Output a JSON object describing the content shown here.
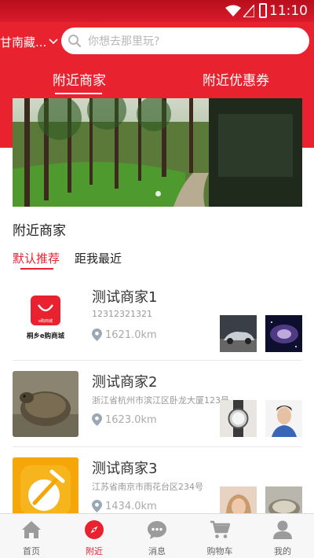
{
  "status_bar": {
    "time": "11:10"
  },
  "header": {
    "city": "甘南藏...",
    "search_placeholder": "你想去那里玩?",
    "tabs": [
      {
        "label": "附近商家"
      },
      {
        "label": "附近优惠券"
      }
    ]
  },
  "section": {
    "title": "附近商家",
    "filters": [
      {
        "label": "默认推荐"
      },
      {
        "label": "距我最近"
      }
    ]
  },
  "shops": [
    {
      "name": "测试商家1",
      "sub": "12312321321",
      "distance": "1621.0km",
      "logo_text": "桐乡e购商城",
      "logo_badge": "e购商城"
    },
    {
      "name": "测试商家2",
      "sub": "浙江省杭州市滨江区卧龙大厦123号",
      "distance": "1623.0km"
    },
    {
      "name": "测试商家3",
      "sub": "江苏省南京市雨花台区234号",
      "distance": "1434.0km"
    }
  ],
  "tabbar": [
    {
      "label": "首页",
      "icon": "home-icon"
    },
    {
      "label": "附近",
      "icon": "compass-icon"
    },
    {
      "label": "消息",
      "icon": "message-icon"
    },
    {
      "label": "购物车",
      "icon": "cart-icon"
    },
    {
      "label": "我的",
      "icon": "user-icon"
    }
  ],
  "colors": {
    "primary": "#e8222f",
    "tab_inactive": "#666666",
    "muted_text": "#999999"
  }
}
